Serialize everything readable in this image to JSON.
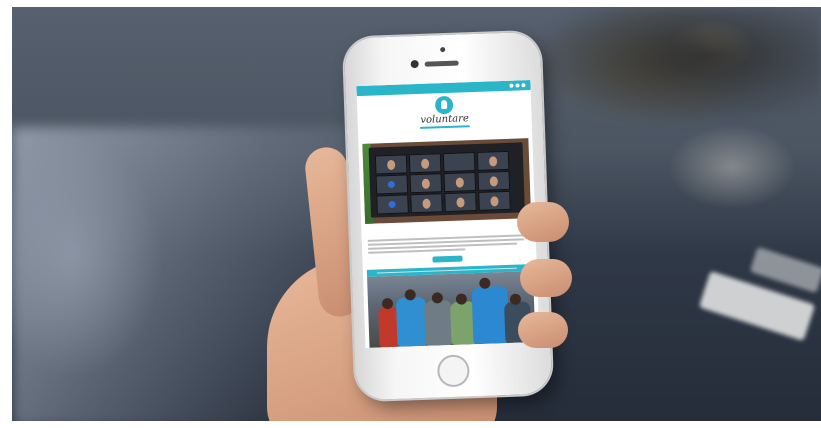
{
  "screen": {
    "brand": {
      "name": "voluntare",
      "accent_color": "#2bb5c9"
    },
    "topbar": {
      "text": "",
      "icons": [
        "social-icon",
        "social-icon",
        "social-icon"
      ]
    },
    "menu": {
      "items": []
    },
    "article": {
      "title": "",
      "button_label": ""
    },
    "banner_text": ""
  }
}
